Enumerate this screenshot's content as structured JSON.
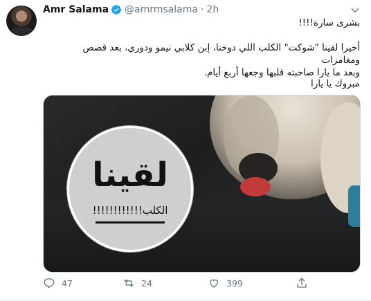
{
  "tweet": {
    "author_name": "Amr Salama",
    "handle": "@amrmsalama",
    "dot": "·",
    "time": "2h",
    "line1": "بشرى سارة!!!!",
    "line2a": "أخيرا لقينا \"شوكت\" الكلب اللي دوخنا، إبن كلابي نيمو ودوري، بعد قصص ومغامرات",
    "line2b": "وبعد ما يارا صاحبته قلبها وجعها أربع أيام.",
    "line3": "مبروك يا يارا",
    "media": {
      "sticker_big": "لقينا",
      "sticker_small": "الكلب!!!!!!!!!!!!"
    },
    "actions": {
      "replies": "47",
      "retweets": "24",
      "likes": "399"
    }
  },
  "colors": {
    "verified": "#1da1f2",
    "muted": "#657786",
    "text": "#14171a"
  }
}
